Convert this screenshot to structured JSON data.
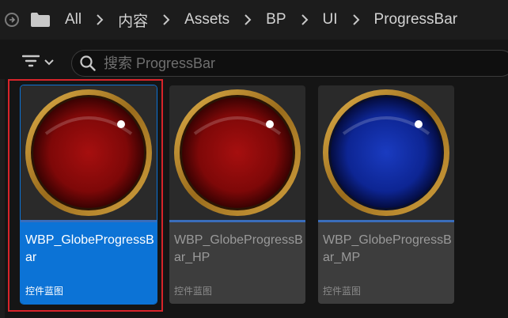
{
  "breadcrumb": {
    "items": [
      "All",
      "内容",
      "Assets",
      "BP",
      "UI",
      "ProgressBar"
    ]
  },
  "search": {
    "placeholder": "搜索 ProgressBar",
    "value": ""
  },
  "assets": [
    {
      "name": "WBP_GlobeProgressBar",
      "type": "控件蓝图",
      "selected": true,
      "globe_color": "red"
    },
    {
      "name": "WBP_GlobeProgressBar_HP",
      "type": "控件蓝图",
      "selected": false,
      "globe_color": "red"
    },
    {
      "name": "WBP_GlobeProgressBar_MP",
      "type": "控件蓝图",
      "selected": false,
      "globe_color": "blue"
    }
  ],
  "colors": {
    "selected_tile": "#0c73d6",
    "highlight_outline": "#d8242a",
    "globe_red": "#8e0b0b",
    "globe_blue": "#0f2a9a",
    "globe_rim": "#c0902a"
  },
  "icons": {
    "nav": "circle-arrow-icon",
    "folder": "folder-icon",
    "separator": "chevron-right-icon",
    "filter": "filter-icon",
    "search": "search-icon",
    "badge": "widget-blueprint-icon"
  }
}
